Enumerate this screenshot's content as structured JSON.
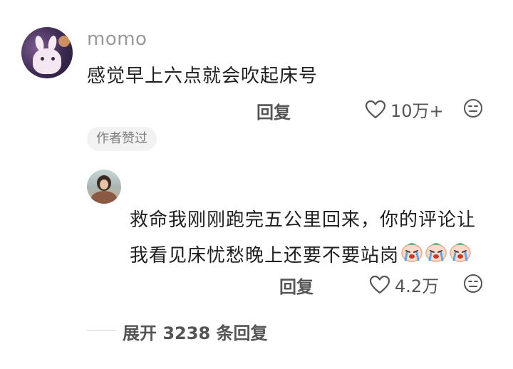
{
  "comment": {
    "username": "momo",
    "text": "感觉早上六点就会吹起床号",
    "reply_label": "回复",
    "like_count": "10万+",
    "author_badge": "作者赞过",
    "avatar_icon": "bunny-avatar"
  },
  "reply": {
    "text": "救命我刚刚跑完五公里回来，你的评论让我看见床忧愁晚上还要不要站岗",
    "emoji_icons": [
      "crying-face-emoji",
      "crying-face-emoji",
      "crying-face-emoji"
    ],
    "reply_label": "回复",
    "like_count": "4.2万",
    "avatar_icon": "person-avatar"
  },
  "expand": {
    "label": "展开 3238 条回复"
  },
  "colors": {
    "text_primary": "#1f1f1f",
    "text_secondary": "#9a9a9a",
    "action_text": "#555555",
    "badge_bg": "#f2f2f2"
  }
}
